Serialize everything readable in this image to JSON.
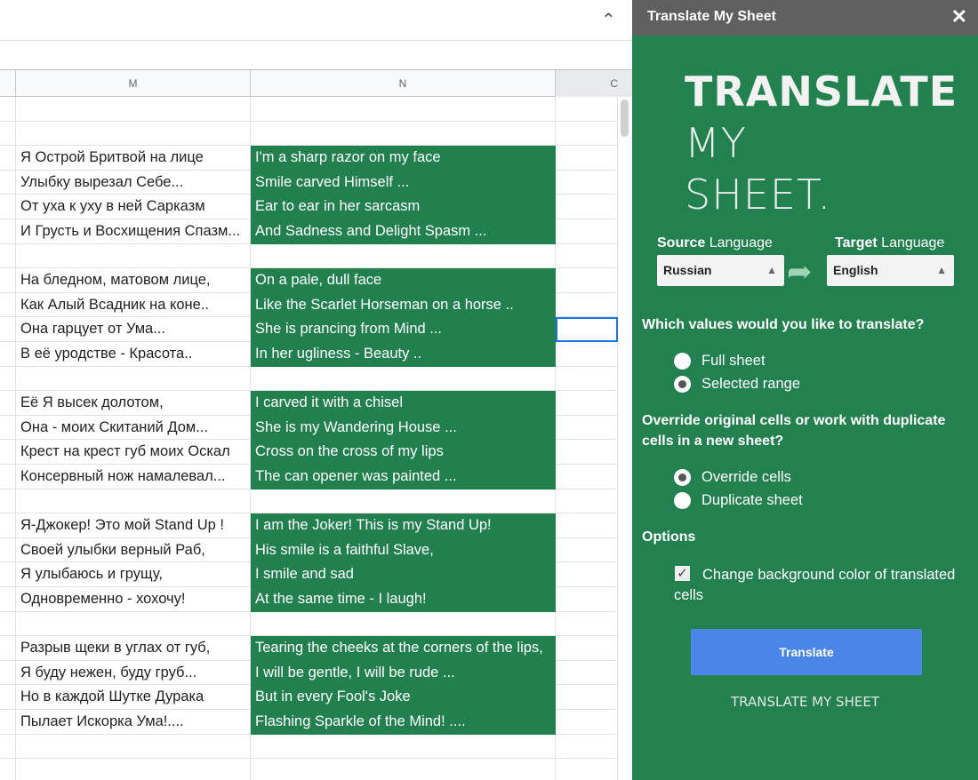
{
  "sheet": {
    "columns": [
      {
        "label": ""
      },
      {
        "label": "M"
      },
      {
        "label": "N"
      },
      {
        "label": "C"
      }
    ],
    "rows": [
      [
        "",
        ""
      ],
      [
        "",
        ""
      ],
      [
        "Я Острой Бритвой  на лице",
        "I'm a sharp razor on my face"
      ],
      [
        "Улыбку вырезал Себе...",
        "Smile carved Himself ..."
      ],
      [
        "От уха к уху в ней  Сарказм",
        "Ear to ear in her sarcasm"
      ],
      [
        "И Грусть и Восхищения Спазм...",
        "And Sadness and Delight Spasm ..."
      ],
      [
        "",
        ""
      ],
      [
        "На бледном, матовом лице,",
        "On a pale, dull face"
      ],
      [
        "Как Алый Всадник на коне..",
        "Like the Scarlet Horseman on a horse .."
      ],
      [
        "Она гарцует от Ума...",
        "She is prancing from Mind ..."
      ],
      [
        "В её  уродстве - Красота..",
        "In her ugliness - Beauty .."
      ],
      [
        "",
        ""
      ],
      [
        "Её Я  высек долотом,",
        "I carved it with a chisel"
      ],
      [
        "Она - моих Скитаний Дом...",
        "She is my Wandering House ..."
      ],
      [
        "Крест на крест губ моих Оскал",
        "Cross on the cross of my lips"
      ],
      [
        "Консервный нож намалевал...",
        "The can opener was painted ..."
      ],
      [
        "",
        ""
      ],
      [
        "Я-Джокер! Это мой Stand Up !",
        "I am the Joker! This is my Stand Up!"
      ],
      [
        "Своей улыбки верный Раб,",
        "His smile is a faithful Slave,"
      ],
      [
        "Я улыбаюсь и грущу,",
        "I smile and sad"
      ],
      [
        "Одновременно - хохочу!",
        "At the same time - I laugh!"
      ],
      [
        "",
        ""
      ],
      [
        "Разрыв щеки в углах от губ,",
        "Tearing the cheeks at the corners of the lips,"
      ],
      [
        "Я буду нежен, буду груб...",
        "I will be gentle, I will be rude ..."
      ],
      [
        "Но в каждой Шутке Дурака",
        "But in every Fool's Joke"
      ],
      [
        "Пылает Искорка  Ума!....",
        "Flashing Sparkle of the Mind! ...."
      ],
      [
        "",
        ""
      ],
      [
        "",
        ""
      ]
    ]
  },
  "panel": {
    "title": "Translate My Sheet",
    "logo": {
      "line1": "TRANSLATE",
      "line2": "MY",
      "line3": "SHEET."
    },
    "source_bold": "Source",
    "source_rest": " Language",
    "source_value": "Russian",
    "target_bold": "Target",
    "target_rest": " Language",
    "target_value": "English",
    "q1": "Which values would you like to translate?",
    "opt_full": "Full sheet",
    "opt_range": "Selected range",
    "q2": "Override original cells or work with duplicate cells in a new sheet?",
    "opt_override": "Override cells",
    "opt_duplicate": "Duplicate sheet",
    "options_heading": "Options",
    "checkbox_label": "Change background color of translated cells",
    "translate_button": "Translate",
    "footer": "TRANSLATE MY SHEET"
  },
  "colors": {
    "panel": "#23804f",
    "header": "#5f5f5f",
    "button": "#4a86e8"
  }
}
